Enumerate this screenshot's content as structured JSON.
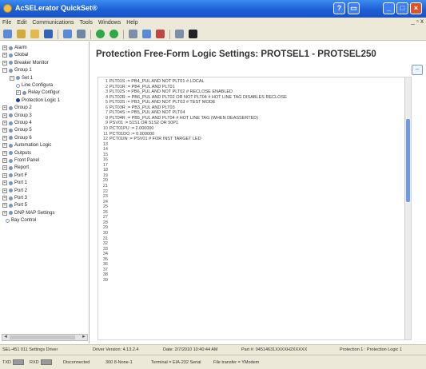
{
  "window": {
    "title": "AcSELerator QuickSet®",
    "colors": {
      "titlebar": "#1d5fd6",
      "close": "#d9542a",
      "chrome": "#ece9d8"
    }
  },
  "menu": {
    "items": [
      "File",
      "Edit",
      "Communications",
      "Tools",
      "Windows",
      "Help"
    ],
    "mdi_controls": "_ ▫ x"
  },
  "toolbar": {
    "icons": [
      "open-icon",
      "save-icon",
      "folder-icon",
      "floppy-icon",
      "refresh-icon",
      "print-icon",
      "green-dot-icon",
      "green-dot-icon",
      "settings-icon",
      "send-icon",
      "receive-icon",
      "connect-icon",
      "terminal-icon"
    ]
  },
  "tree": {
    "items": [
      {
        "label": "Alarm",
        "exp": "+"
      },
      {
        "label": "Global",
        "exp": "+"
      },
      {
        "label": "Breaker Monitor",
        "exp": "+"
      },
      {
        "label": "Group 1",
        "exp": "−"
      },
      {
        "label": "Set 1",
        "exp": "−"
      },
      {
        "label": "Line Configura",
        "exp": ""
      },
      {
        "label": "Relay Configur",
        "exp": "+"
      },
      {
        "label": "Protection Logic 1",
        "exp": ""
      },
      {
        "label": "Group 2",
        "exp": "+"
      },
      {
        "label": "Group 3",
        "exp": "+"
      },
      {
        "label": "Group 4",
        "exp": "+"
      },
      {
        "label": "Group 5",
        "exp": "+"
      },
      {
        "label": "Group 6",
        "exp": "+"
      },
      {
        "label": "Automation Logic",
        "exp": "+"
      },
      {
        "label": "Outputs",
        "exp": "+"
      },
      {
        "label": "Front Panel",
        "exp": "+"
      },
      {
        "label": "Report",
        "exp": "+"
      },
      {
        "label": "Port F",
        "exp": "+"
      },
      {
        "label": "Port 1",
        "exp": "+"
      },
      {
        "label": "Port 2",
        "exp": "+"
      },
      {
        "label": "Port 3",
        "exp": "+"
      },
      {
        "label": "Port 5",
        "exp": "+"
      },
      {
        "label": "DNP MAP Settings",
        "exp": "+"
      },
      {
        "label": "Bay Control",
        "exp": ""
      }
    ]
  },
  "main": {
    "title": "Protection Free-Form Logic Settings: PROTSEL1 - PROTSEL250",
    "code_lines": [
      {
        "n": "1",
        "text": "PLT01S := PB4_PUL AND NOT PLT01 # LOCAL"
      },
      {
        "n": "2",
        "text": "PLT01R := PB4_PUL AND PLT01"
      },
      {
        "n": "3",
        "text": "PLT02S := PB6_PUL AND NOT PLT02 # RECLOSE ENABLED"
      },
      {
        "n": "4",
        "text": "PLT02R := PB6_PUL AND PLT02 OR NOT PLT04 # HOT LINE TAG DISABLES RECLOSE"
      },
      {
        "n": "5",
        "text": "PLT03S := PB3_PUL AND NOT PLT03 # TEST MODE"
      },
      {
        "n": "6",
        "text": "PLT03R := PB3_PUL AND PLT03"
      },
      {
        "n": "7",
        "text": "PLT04S := PB5_PUL AND NOT PLT04"
      },
      {
        "n": "8",
        "text": "PLT04R := PB5_PUL AND PLT04 # HOT LINE TAG (WHEN DEASSERTED)"
      },
      {
        "n": "9",
        "text": "PSV01 := 51S1 OR 51S2 OR 50P1"
      },
      {
        "n": "10",
        "text": "PCT01PU := 2.000000"
      },
      {
        "n": "11",
        "text": "PCT01DO := 0.000000"
      },
      {
        "n": "12",
        "text": "PCT01IN := PSV01 # FOR INST TARGET LED"
      },
      {
        "n": "13",
        "text": ""
      },
      {
        "n": "14",
        "text": ""
      },
      {
        "n": "15",
        "text": ""
      },
      {
        "n": "16",
        "text": ""
      },
      {
        "n": "17",
        "text": ""
      },
      {
        "n": "18",
        "text": ""
      },
      {
        "n": "19",
        "text": ""
      },
      {
        "n": "20",
        "text": ""
      },
      {
        "n": "21",
        "text": ""
      },
      {
        "n": "22",
        "text": ""
      },
      {
        "n": "23",
        "text": ""
      },
      {
        "n": "24",
        "text": ""
      },
      {
        "n": "25",
        "text": ""
      },
      {
        "n": "26",
        "text": ""
      },
      {
        "n": "27",
        "text": ""
      },
      {
        "n": "28",
        "text": ""
      },
      {
        "n": "29",
        "text": ""
      },
      {
        "n": "30",
        "text": ""
      },
      {
        "n": "31",
        "text": ""
      },
      {
        "n": "32",
        "text": ""
      },
      {
        "n": "33",
        "text": ""
      },
      {
        "n": "34",
        "text": ""
      },
      {
        "n": "35",
        "text": ""
      },
      {
        "n": "36",
        "text": ""
      },
      {
        "n": "37",
        "text": ""
      },
      {
        "n": "38",
        "text": ""
      },
      {
        "n": "39",
        "text": ""
      }
    ]
  },
  "status": {
    "driver": "SEL-451 011 Settings Driver",
    "version": "Driver Version: 4.13.2.4",
    "date": "Date: 2/7/2010 10:40:44 AM",
    "part": "Part #: 04514631XXXXH2XXXXX",
    "location": "Protection 1 : Protection Logic 1",
    "txd": "TXD",
    "rxd": "RXD",
    "connection": "Disconnected",
    "parity": "300 8-None-1",
    "terminal": "Terminal = EIA-232 Serial",
    "transfer": "File transfer = YModem"
  }
}
